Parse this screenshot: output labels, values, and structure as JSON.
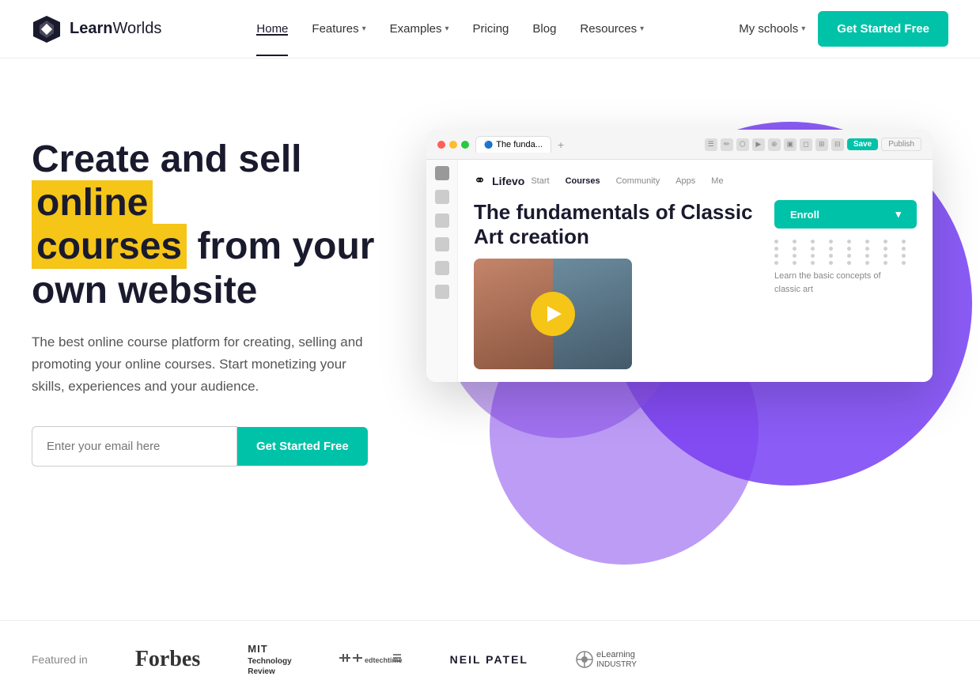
{
  "nav": {
    "logo_text_bold": "Learn",
    "logo_text_light": "Worlds",
    "links": [
      {
        "label": "Home",
        "active": true,
        "has_chevron": false
      },
      {
        "label": "Features",
        "active": false,
        "has_chevron": true
      },
      {
        "label": "Examples",
        "active": false,
        "has_chevron": true
      },
      {
        "label": "Pricing",
        "active": false,
        "has_chevron": false
      },
      {
        "label": "Blog",
        "active": false,
        "has_chevron": false
      },
      {
        "label": "Resources",
        "active": false,
        "has_chevron": true
      }
    ],
    "myschools_label": "My schools",
    "cta_label": "Get Started Free"
  },
  "hero": {
    "title_part1": "Create and sell ",
    "title_highlight1": "online",
    "title_part2": " ",
    "title_highlight2": "courses",
    "title_part3": " from your own website",
    "description": "The best online course platform for creating, selling and promoting your online courses. Start monetizing your skills, experiences and your audience.",
    "email_placeholder": "Enter your email here",
    "cta_label": "Get Started Free"
  },
  "browser_mockup": {
    "tab_label": "The funda...",
    "save_label": "Save",
    "preview_label": "Publish",
    "course_logo": "Lifevo",
    "course_nav": [
      "Start",
      "Courses",
      "Community",
      "Apps",
      "Me"
    ],
    "course_title": "The fundamentals of Classic Art creation",
    "enroll_label": "Enroll",
    "course_desc": "Learn the basic concepts of classic art"
  },
  "featured": {
    "label": "Featured in",
    "logos": [
      {
        "name": "Forbes",
        "type": "forbes"
      },
      {
        "name": "MIT Technology Review",
        "type": "mit"
      },
      {
        "name": "edtechtimes",
        "type": "edtechtimes"
      },
      {
        "name": "NEIL PATEL",
        "type": "neilpatel"
      },
      {
        "name": "eLearning Industry",
        "type": "elearning"
      }
    ]
  }
}
